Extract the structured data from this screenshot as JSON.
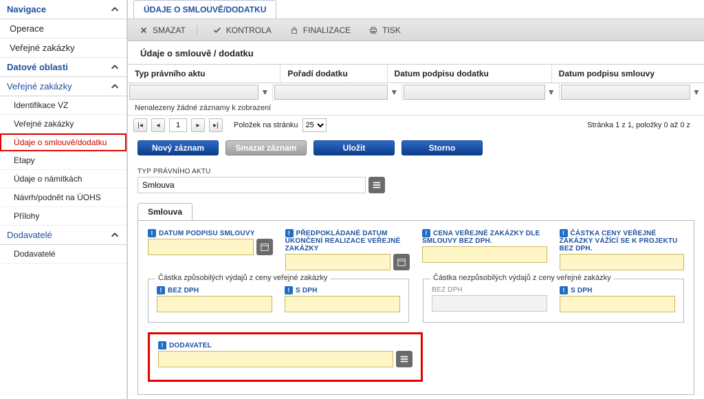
{
  "nav": {
    "navigace": "Navigace",
    "operace": "Operace",
    "verejne_zakazky_top": "Veřejné zakázky",
    "datove_oblasti": "Datové oblasti",
    "verejne_zakazky": "Veřejné zakázky",
    "identifikace_vz": "Identifikace VZ",
    "verejne_zakazky_sub": "Veřejné zakázky",
    "udaje_o_smlouve": "Údaje o smlouvě/dodatku",
    "etapy": "Etapy",
    "udaje_o_namitkach": "Údaje o námitkách",
    "navrh_podnet": "Návrh/podnět na ÚOHS",
    "prilohy": "Přílohy",
    "dodavatele": "Dodavatelé",
    "dodavatele_sub": "Dodavatelé"
  },
  "tabs": {
    "main": "ÚDAJE O SMLOUVĚ/DODATKU",
    "sub": "Smlouva"
  },
  "toolbar": {
    "smazat": "SMAZAT",
    "kontrola": "KONTROLA",
    "finalizace": "FINALIZACE",
    "tisk": "TISK"
  },
  "section_title": "Údaje o smlouvě / dodatku",
  "grid_headers": {
    "typ": "Typ právního aktu",
    "poradi": "Pořadí dodatku",
    "datum_dod": "Datum podpisu dodatku",
    "datum_sml": "Datum podpisu smlouvy"
  },
  "grid_empty": "Nenalezeny žádné záznamy k zobrazení",
  "pager": {
    "page": "1",
    "per_page_label": "Položek na stránku",
    "per_page": "25",
    "status": "Stránka 1 z 1, položky 0 až 0 z"
  },
  "buttons": {
    "novy": "Nový záznam",
    "smazat": "Smazat záznam",
    "ulozit": "Uložit",
    "storno": "Storno"
  },
  "form": {
    "typ_label": "TYP PRÁVNÍHO AKTU",
    "typ_value": "Smlouva",
    "datum_podpisu_sml": "DATUM PODPISU SMLOUVY",
    "predpokl_datum": "PŘEDPOKLÁDANÉ DATUM UKONČENÍ REALIZACE VEŘEJNÉ ZAKÁZKY",
    "cena_dle_sml": "CENA VEŘEJNÉ ZAKÁZKY DLE SMLOUVY BEZ DPH.",
    "castka_ceny": "ČÁSTKA CENY VEŘEJNÉ ZAKÁZKY VÁŽÍCÍ SE K PROJEKTU BEZ DPH.",
    "zpusob_legend": "Částka způsobilých výdajů z ceny veřejné zakázky",
    "nezpusob_legend": "Částka nezpůsobilých výdajů z ceny veřejné zakázky",
    "bez_dph": "BEZ DPH",
    "s_dph": "S DPH",
    "dodavatel": "DODAVATEL"
  }
}
